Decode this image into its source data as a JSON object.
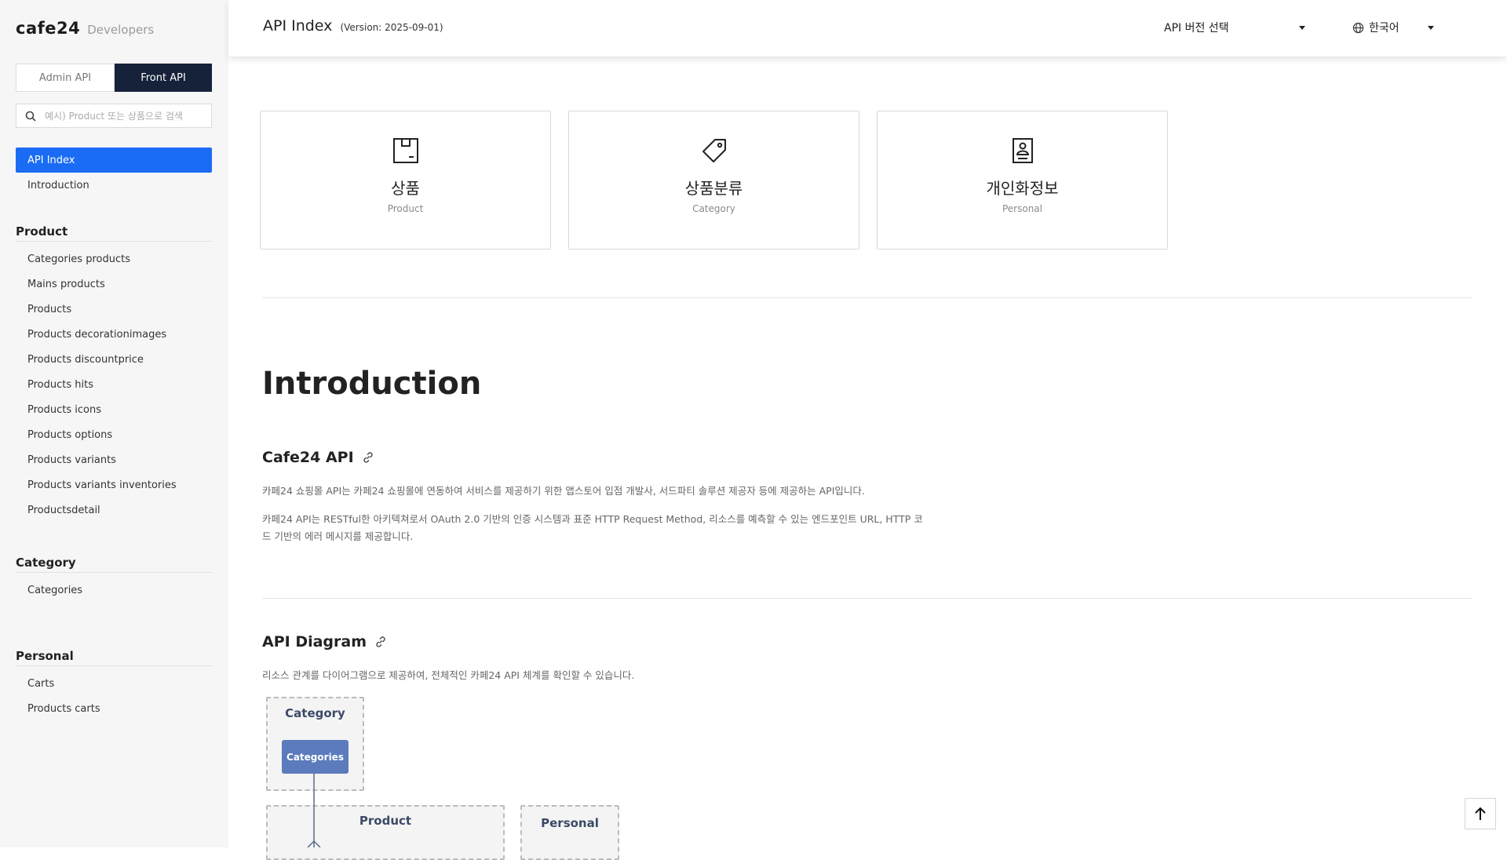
{
  "sidebar": {
    "logo": "cafe24",
    "logo_sub": "Developers",
    "tabs": [
      {
        "label": "Admin API",
        "active": false
      },
      {
        "label": "Front API",
        "active": true
      }
    ],
    "search_placeholder": "예시) Product 또는 상품으로 검색",
    "top_items": [
      {
        "label": "API Index",
        "active": true
      },
      {
        "label": "Introduction",
        "active": false
      }
    ],
    "sections": [
      {
        "title": "Product",
        "items": [
          "Categories products",
          "Mains products",
          "Products",
          "Products decorationimages",
          "Products discountprice",
          "Products hits",
          "Products icons",
          "Products options",
          "Products variants",
          "Products variants inventories",
          "Productsdetail"
        ]
      },
      {
        "title": "Category",
        "items": [
          "Categories"
        ]
      },
      {
        "title": "Personal",
        "items": [
          "Carts",
          "Products carts"
        ]
      }
    ]
  },
  "header": {
    "title": "API Index",
    "version": "(Version: 2025-09-01)",
    "version_select": "API 버전 선택",
    "language_select": "한국어"
  },
  "cards": [
    {
      "title": "상품",
      "subtitle": "Product",
      "icon": "box-icon"
    },
    {
      "title": "상품분류",
      "subtitle": "Category",
      "icon": "tag-icon"
    },
    {
      "title": "개인화정보",
      "subtitle": "Personal",
      "icon": "person-card-icon"
    }
  ],
  "intro": {
    "heading": "Introduction",
    "cafe24_api": {
      "title": "Cafe24 API",
      "p1": "카페24 쇼핑몰 API는 카페24 쇼핑몰에 연동하여 서비스를 제공하기 위한 앱스토어 입점 개발사, 서드파티 솔루션 제공자 등에 제공하는 API입니다.",
      "p2": "카페24 API는 RESTful한 아키텍쳐로서 OAuth 2.0 기반의 인증 시스템과 표준 HTTP Request Method, 리소스를 예측할 수 있는 엔드포인트 URL, HTTP 코드 기반의 에러 메시지를 제공합니다."
    },
    "api_diagram": {
      "title": "API Diagram",
      "desc": "리소스 관계를 다이어그램으로 제공하여, 전체적인 카페24 API 체계를 확인할 수 있습니다.",
      "groups": [
        {
          "title": "Category",
          "nodes": [
            "Categories"
          ]
        },
        {
          "title": "Product",
          "nodes": []
        },
        {
          "title": "Personal",
          "nodes": []
        }
      ]
    }
  },
  "colors": {
    "accent": "#1a6cf5",
    "tab_active": "#16223a",
    "diagram_node": "#5b7bbd"
  }
}
